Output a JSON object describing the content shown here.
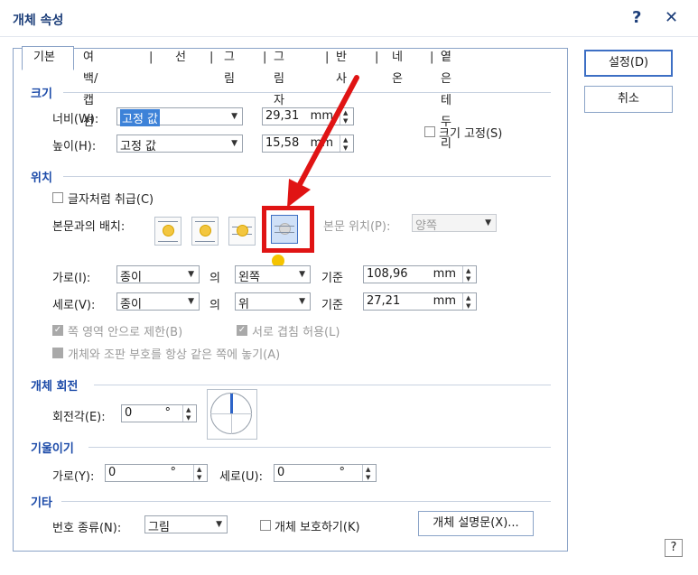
{
  "window": {
    "title": "개체 속성",
    "help_glyph": "?",
    "close_glyph": "✕"
  },
  "tabs": [
    "기본",
    "여백/캡션",
    "선",
    "그림",
    "그림자",
    "반사",
    "네온",
    "옅은 테두리"
  ],
  "buttons": {
    "ok": "설정(D)",
    "cancel": "취소",
    "help_corner": "?"
  },
  "size": {
    "section": "크기",
    "width_label": "너비(W):",
    "width_mode": "고정 값",
    "width_value": "29,31",
    "width_unit": "mm",
    "height_label": "높이(H):",
    "height_mode": "고정 값",
    "height_value": "15,58",
    "height_unit": "mm",
    "lock_label": "크기 고정(S)",
    "lock_checked": false
  },
  "position": {
    "section": "위치",
    "treat_as_char_label": "글자처럼 취급(C)",
    "treat_as_char_checked": false,
    "wrap_label": "본문과의 배치:",
    "wrap_options": [
      "square-wrap-icon",
      "top-bottom-wrap-icon",
      "behind-text-icon",
      "in-front-of-text-icon"
    ],
    "selected_wrap": 3,
    "text_pos_label": "본문 위치(P):",
    "text_pos_value": "양쪽",
    "horiz_label": "가로(I):",
    "horiz_ref": "종이",
    "horiz_of": "의",
    "horiz_align": "왼쪽",
    "horiz_base": "기준",
    "horiz_value": "108,96",
    "horiz_unit": "mm",
    "vert_label": "세로(V):",
    "vert_ref": "종이",
    "vert_of": "의",
    "vert_align": "위",
    "vert_base": "기준",
    "vert_value": "27,21",
    "vert_unit": "mm",
    "limit_label": "쪽 영역 안으로 제한(B)",
    "overlap_label": "서로 겹침 허용(L)",
    "same_page_label": "개체와 조판 부호를 항상 같은 쪽에 놓기(A)"
  },
  "rotation": {
    "section": "개체 회전",
    "angle_label": "회전각(E):",
    "angle_value": "0",
    "angle_unit": "°"
  },
  "skew": {
    "section": "기울이기",
    "h_label": "가로(Y):",
    "h_value": "0",
    "v_label": "세로(U):",
    "v_value": "0",
    "unit": "°"
  },
  "other": {
    "section": "기타",
    "number_type_label": "번호 종류(N):",
    "number_type_value": "그림",
    "protect_label": "개체 보호하기(K)",
    "desc_button": "개체 설명문(X)..."
  },
  "colors": {
    "accent": "#1b4aa8",
    "annotation_red": "#e01414",
    "marker_yellow": "#f5c400"
  }
}
